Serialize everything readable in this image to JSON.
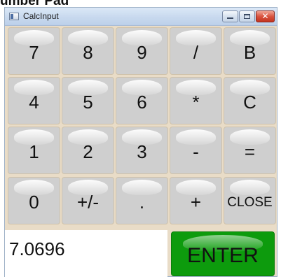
{
  "page_heading": "umber Pad",
  "window": {
    "title": "CalcInput",
    "caption_buttons": {
      "minimize": "—",
      "maximize": "□",
      "close": "✕"
    }
  },
  "keypad": {
    "rows": [
      [
        "7",
        "8",
        "9",
        "/",
        "B"
      ],
      [
        "4",
        "5",
        "6",
        "*",
        "C"
      ],
      [
        "1",
        "2",
        "3",
        "-",
        "="
      ],
      [
        "0",
        "+/-",
        ".",
        "+",
        "CLOSE"
      ]
    ]
  },
  "display": {
    "value": "7.0696"
  },
  "enter": {
    "label": "ENTER",
    "color": "#0d9b0d"
  }
}
